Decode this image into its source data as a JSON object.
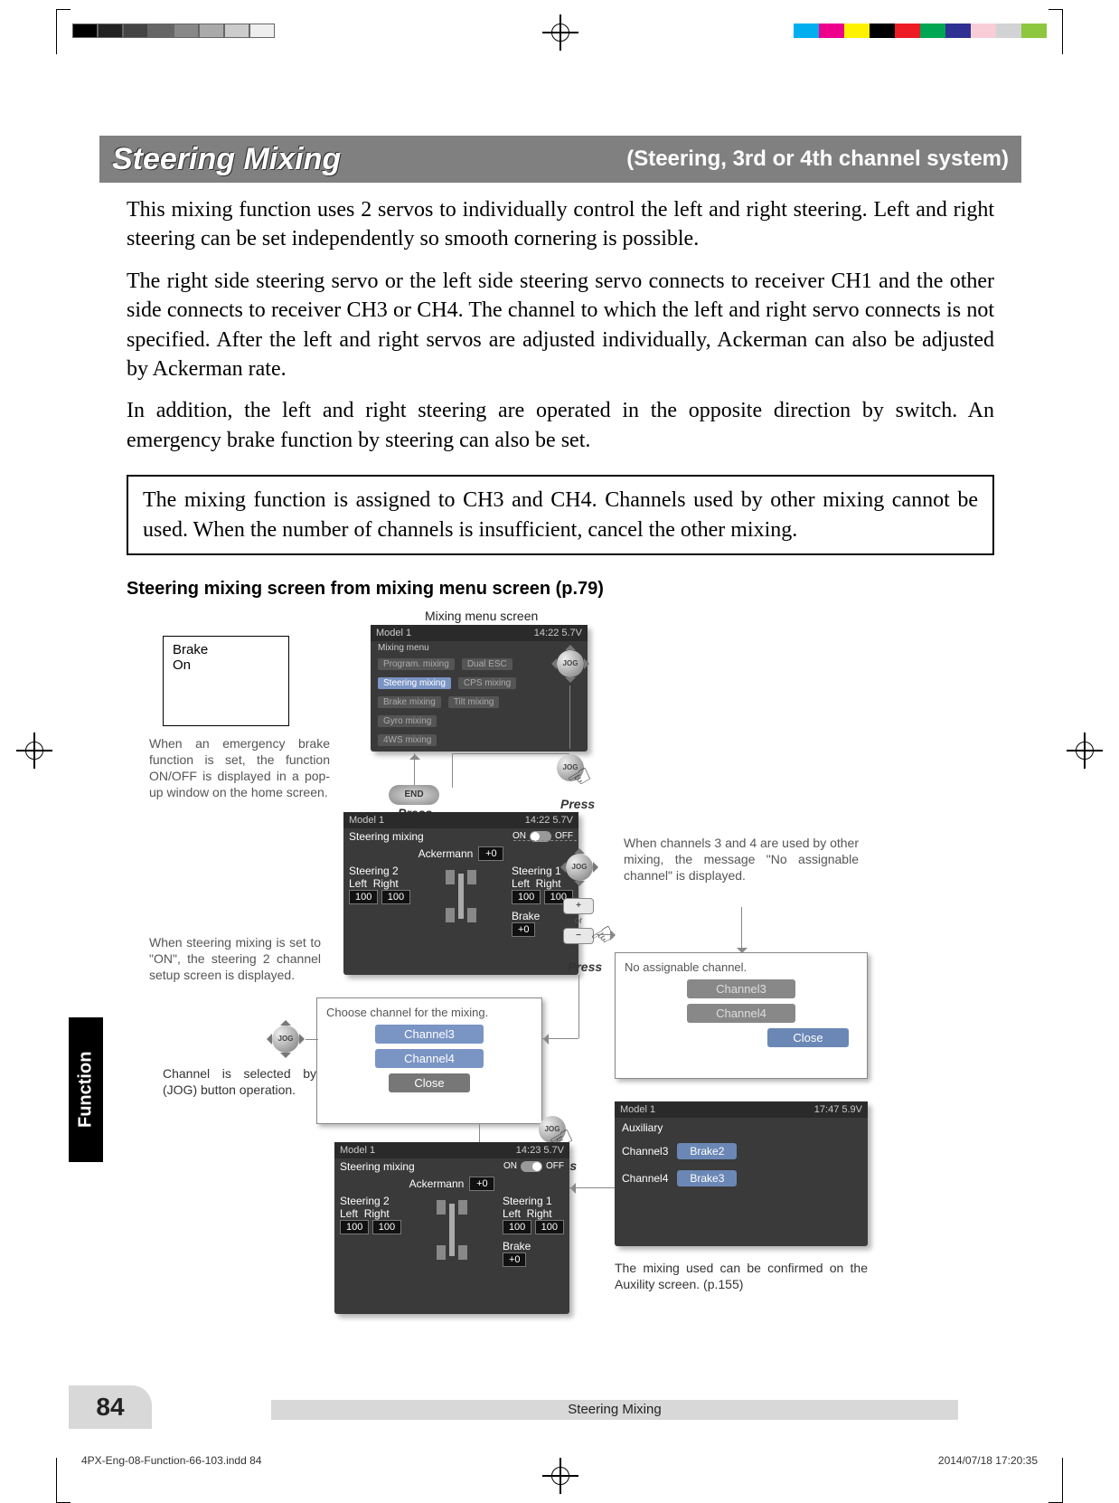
{
  "titleBar": {
    "title": "Steering Mixing",
    "subtitle": "(Steering, 3rd or 4th channel system)"
  },
  "paragraphs": {
    "p1": "This mixing function uses 2 servos to individually control the left and right steering. Left and right steering can be set independently so smooth cornering is possible.",
    "p2": "The right side steering servo or the left side steering servo connects to receiver CH1 and the other side connects to receiver CH3 or CH4. The channel to which the left and right servo connects is not specified. After the left and right servos are adjusted individually, Ackerman can also be adjusted by Ackerman rate.",
    "p3": "In addition, the left and right steering are operated in the opposite direction by switch. An emergency brake function by steering can also be set."
  },
  "caution": "The mixing function is assigned to CH3 and CH4. Channels used by other mixing cannot be used. When the number of channels is insufficient, cancel the other mixing.",
  "sectionHeading": "Steering mixing screen from mixing menu screen (p.79)",
  "labels": {
    "mixingMenuScreen": "Mixing menu screen",
    "brakeBoxLine1": "Brake",
    "brakeBoxLine2": "On",
    "brakeInfo": "When an emergency brake function is set, the function ON/OFF is displayed in a pop-up window on the home screen.",
    "steerOnInfo": "When steering mixing is set to \"ON\", the steering 2 channel setup screen is displayed.",
    "channelJogInfo": "Channel is selected by (JOG) button operation.",
    "noAssignInfo": "When channels 3 and 4 are used by other mixing, the message \"No assignable channel\" is displayed.",
    "auxInfo": "The mixing used can be confirmed on the Auxility screen. (p.155)",
    "press": "Press",
    "end": "END",
    "jog": "JOG",
    "or": "or"
  },
  "mixMenu": {
    "header": {
      "left": "Model 1",
      "right": "14:22 5.7V"
    },
    "title": "Mixing menu",
    "items": [
      [
        "Program. mixing",
        "Dual ESC"
      ],
      [
        "Steering mixing",
        "CPS mixing"
      ],
      [
        "Brake mixing",
        "Tilt mixing"
      ],
      [
        "Gyro mixing",
        ""
      ],
      [
        "4WS mixing",
        ""
      ]
    ],
    "selectedRow": 1
  },
  "steerScreen": {
    "header": {
      "left": "Model 1",
      "right": "14:22 5.7V"
    },
    "title": "Steering mixing",
    "toggle": {
      "on": "ON",
      "off": "OFF"
    },
    "ackermann": "Ackermann",
    "ackVal": "+0",
    "st2": "Steering 2",
    "st1": "Steering 1",
    "left": "Left",
    "right": "Right",
    "val": "100",
    "brake": "Brake",
    "brakeVal": "+0"
  },
  "chooseDialog": {
    "title": "Choose channel for the mixing.",
    "ch3": "Channel3",
    "ch4": "Channel4",
    "close": "Close"
  },
  "noAssignDialog": {
    "title": "No assignable channel.",
    "ch3": "Channel3",
    "ch4": "Channel4",
    "close": "Close"
  },
  "steerScreen2": {
    "header": {
      "left": "Model 1",
      "right": "14:23 5.7V"
    }
  },
  "auxScreen": {
    "header": {
      "left": "Model 1",
      "right": "17:47 5.9V"
    },
    "title": "Auxiliary",
    "rows": [
      {
        "ch": "Channel3",
        "btn": "Brake2"
      },
      {
        "ch": "Channel4",
        "btn": "Brake3"
      }
    ]
  },
  "sideTab": "Function",
  "pageNumber": "84",
  "footer": "Steering Mixing",
  "slugLeft": "4PX-Eng-08-Function-66-103.indd   84",
  "slugRight": "2014/07/18   17:20:35"
}
